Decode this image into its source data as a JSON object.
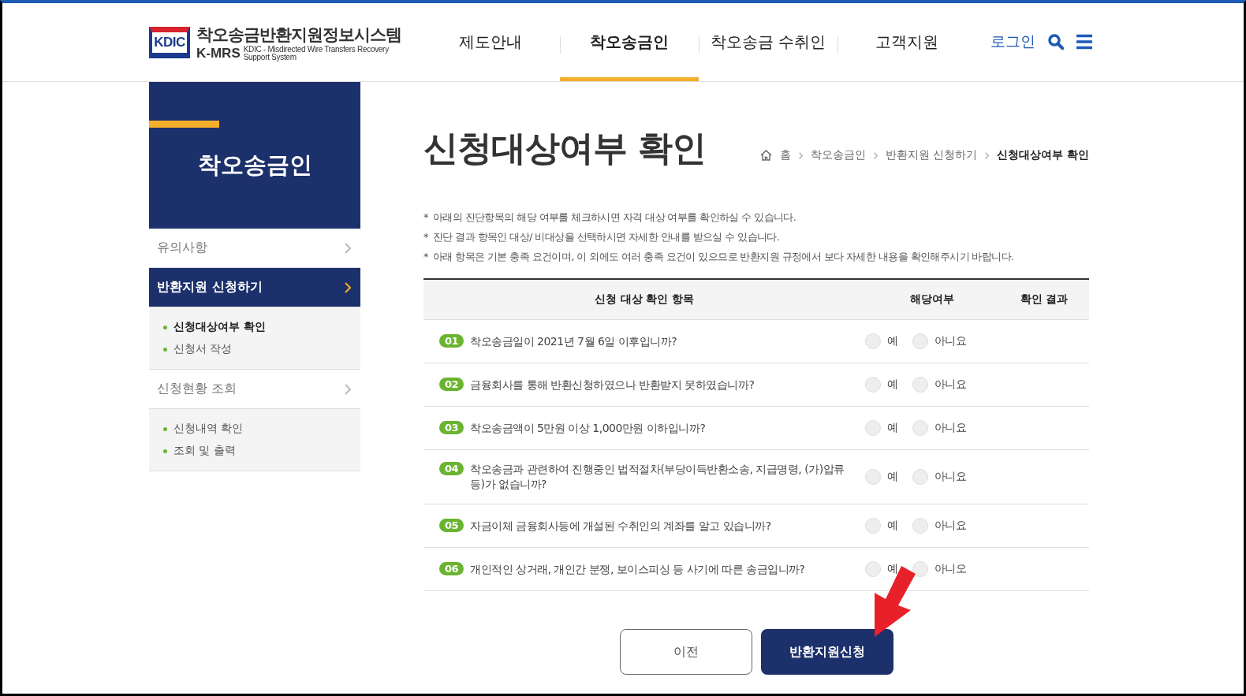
{
  "header": {
    "logo": {
      "badge": "KDIC",
      "title": "착오송금반환지원정보시스템",
      "abbr": "K-MRS",
      "subtitle": "KDIC - Misdirected Wire Transfers Recovery Support System"
    },
    "nav": [
      {
        "label": "제도안내",
        "selected": false
      },
      {
        "label": "착오송금인",
        "selected": true
      },
      {
        "label": "착오송금 수취인",
        "selected": false
      },
      {
        "label": "고객지원",
        "selected": false
      }
    ],
    "login": "로그인"
  },
  "sidebar": {
    "title": "착오송금인",
    "items": [
      {
        "label": "유의사항",
        "selected": false
      },
      {
        "label": "반환지원 신청하기",
        "selected": true,
        "children": [
          {
            "label": "신청대상여부 확인",
            "selected": true
          },
          {
            "label": "신청서 작성",
            "selected": false
          }
        ]
      },
      {
        "label": "신청현황 조회",
        "selected": false,
        "children": [
          {
            "label": "신청내역 확인",
            "selected": false
          },
          {
            "label": "조회 및 출력",
            "selected": false
          }
        ]
      }
    ]
  },
  "page": {
    "title": "신청대상여부 확인",
    "breadcrumb": [
      {
        "label": "홈",
        "current": false
      },
      {
        "label": "착오송금인",
        "current": false
      },
      {
        "label": "반환지원 신청하기",
        "current": false
      },
      {
        "label": "신청대상여부 확인",
        "current": true
      }
    ],
    "notes": [
      "아래의 진단항목의 해당 여부를 체크하시면 자격 대상 여부를 확인하실 수 있습니다.",
      "진단 결과 항목인 대상/ 비대상을 선택하시면 자세한 안내를 받으실 수 있습니다.",
      "아래 항목은 기본 충족 요건이며, 이 외에도 여러 충족 요건이 있으므로 반환지원 규정에서 보다 자세한 내용을 확인해주시기 바랍니다."
    ],
    "note_mark": "*",
    "table": {
      "columns": [
        "신청 대상 확인 항목",
        "해당여부",
        "확인 결과"
      ],
      "rows": [
        {
          "number": "01",
          "question": "착오송금일이 2021년 7월 6일 이후입니까?",
          "options": [
            {
              "label": "예",
              "selected": false
            },
            {
              "label": "아니요",
              "selected": false
            }
          ]
        },
        {
          "number": "02",
          "question": "금융회사를 통해 반환신청하였으나 반환받지 못하였습니까?",
          "options": [
            {
              "label": "예",
              "selected": false
            },
            {
              "label": "아니요",
              "selected": false
            }
          ]
        },
        {
          "number": "03",
          "question": "착오송금액이 5만원 이상 1,000만원 이하입니까?",
          "options": [
            {
              "label": "예",
              "selected": false
            },
            {
              "label": "아니요",
              "selected": false
            }
          ]
        },
        {
          "number": "04",
          "question": "착오송금과 관련하여 진행중인 법적절차(부당이득반환소송, 지급명령, (가)압류 등)가 없습니까?",
          "options": [
            {
              "label": "예",
              "selected": false
            },
            {
              "label": "아니요",
              "selected": false
            }
          ]
        },
        {
          "number": "05",
          "question": "자금이체 금융회사등에 개설된 수취인의 계좌를 알고 있습니까?",
          "options": [
            {
              "label": "예",
              "selected": false
            },
            {
              "label": "아니요",
              "selected": false
            }
          ]
        },
        {
          "number": "06",
          "question": "개인적인 상거래, 개인간 분쟁, 보이스피싱 등 사기에 따른 송금입니까?",
          "options": [
            {
              "label": "예",
              "selected": false
            },
            {
              "label": "아니오",
              "selected": false
            }
          ]
        }
      ]
    },
    "buttons": [
      {
        "label": "이전",
        "kind": "secondary"
      },
      {
        "label": "반환지원신청",
        "kind": "primary"
      }
    ]
  }
}
